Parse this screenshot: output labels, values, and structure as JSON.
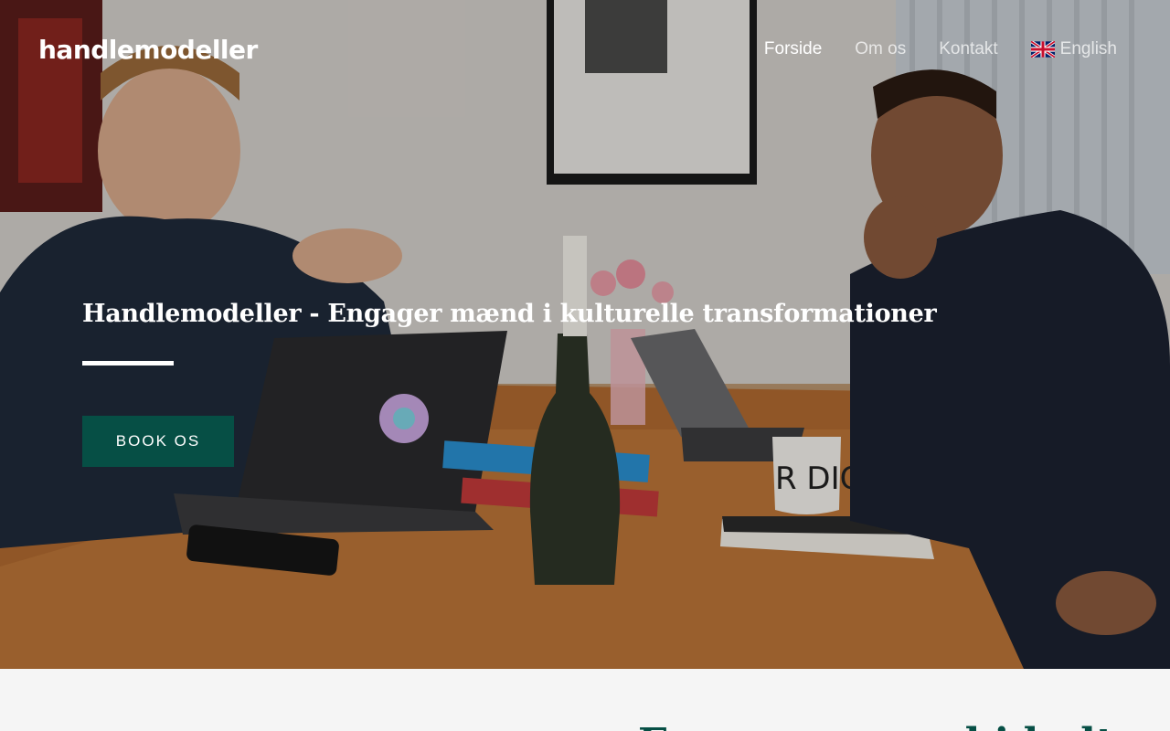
{
  "header": {
    "logo": "handlemodeller",
    "nav": [
      {
        "label": "Forside",
        "active": true
      },
      {
        "label": "Om os",
        "active": false
      },
      {
        "label": "Kontakt",
        "active": false
      },
      {
        "label": "English",
        "active": false,
        "icon": "uk-flag-icon"
      }
    ]
  },
  "hero": {
    "title": "Handlemodeller - Engager mænd i kulturelle transformationer",
    "button_label": "BOOK OS",
    "button_color": "#064f45",
    "mug_text": "R DIG"
  },
  "section": {
    "heading": "Engager mænd i kulturelle"
  }
}
